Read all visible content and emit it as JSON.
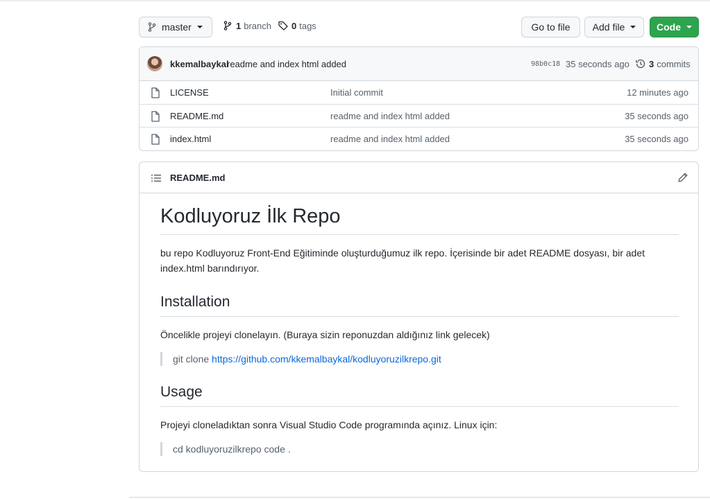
{
  "toolbar": {
    "branch_button": "master",
    "branch_count": "1",
    "branch_label": "branch",
    "tag_count": "0",
    "tag_label": "tags",
    "go_to_file": "Go to file",
    "add_file": "Add file",
    "code": "Code"
  },
  "commit": {
    "author": "kkemalbaykal",
    "message": "readme and index html added",
    "sha": "98b0c18",
    "time": "35 seconds ago",
    "commits_count": "3",
    "commits_label": "commits"
  },
  "files": [
    {
      "name": "LICENSE",
      "commit": "Initial commit",
      "age": "12 minutes ago"
    },
    {
      "name": "README.md",
      "commit": "readme and index html added",
      "age": "35 seconds ago"
    },
    {
      "name": "index.html",
      "commit": "readme and index html added",
      "age": "35 seconds ago"
    }
  ],
  "readme": {
    "header": "README.md",
    "h1": "Kodluyoruz İlk Repo",
    "intro": "bu repo Kodluyoruz Front-End Eğitiminde oluşturduğumuz ilk repo. İçerisinde bir adet README dosyası, bir adet index.html barındırıyor.",
    "installation_heading": "Installation",
    "installation_text": "Öncelikle projeyi clonelayın. (Buraya sizin reponuzdan aldığınız link gelecek)",
    "clone_prefix": "git clone",
    "clone_url": "https://github.com/kkemalbaykal/kodluyoruzilkrepo.git",
    "usage_heading": "Usage",
    "usage_text": "Projeyi cloneladıktan sonra Visual Studio Code programında açınız. Linux için:",
    "usage_cmd": "cd kodluyoruzilkrepo code ."
  },
  "colors": {
    "code_button": "#2da44e",
    "link": "#0969da",
    "border": "#d0d7de"
  }
}
